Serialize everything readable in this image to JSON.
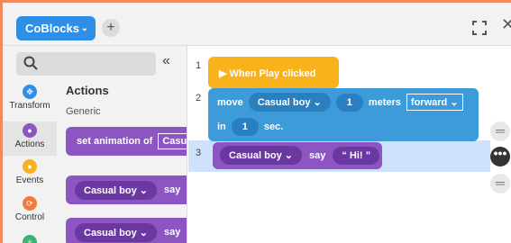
{
  "header": {
    "project_label": "CoBlocks",
    "add_symbol": "+",
    "close_symbol": "✕"
  },
  "sidebar": {
    "collapse_symbol": "«",
    "categories": [
      {
        "label": "Transform",
        "color": "#2f8ee5"
      },
      {
        "label": "Actions",
        "color": "#8d55c2"
      },
      {
        "label": "Events",
        "color": "#f8b31c"
      },
      {
        "label": "Control",
        "color": "#f27a3b"
      },
      {
        "label": "",
        "color": "#3cb371"
      }
    ],
    "section_title": "Actions",
    "section_subtitle": "Generic",
    "palette_blocks": [
      {
        "text": "set animation of",
        "value": "Casual"
      },
      {
        "character": "Casual boy",
        "action": "say"
      },
      {
        "character": "Casual boy",
        "action": "say"
      }
    ]
  },
  "workspace": {
    "line_numbers": [
      "1",
      "2",
      "3"
    ],
    "event_block": "▶ When Play clicked",
    "move_block": {
      "verb": "move",
      "character": "Casual boy",
      "amount": "1",
      "unit": "meters",
      "direction": "forward",
      "in_label": "in",
      "duration": "1",
      "duration_unit": "sec."
    },
    "say_block": {
      "character": "Casual boy",
      "action": "say",
      "text": "“ Hi! ”"
    }
  },
  "colors": {
    "accent": "#2f8ee5",
    "actions": "#8d55c2",
    "events": "#f8b31c",
    "transform_block": "#3d9bd9",
    "highlight_row": "#cfe1fb",
    "frame": "#f08a5d"
  }
}
